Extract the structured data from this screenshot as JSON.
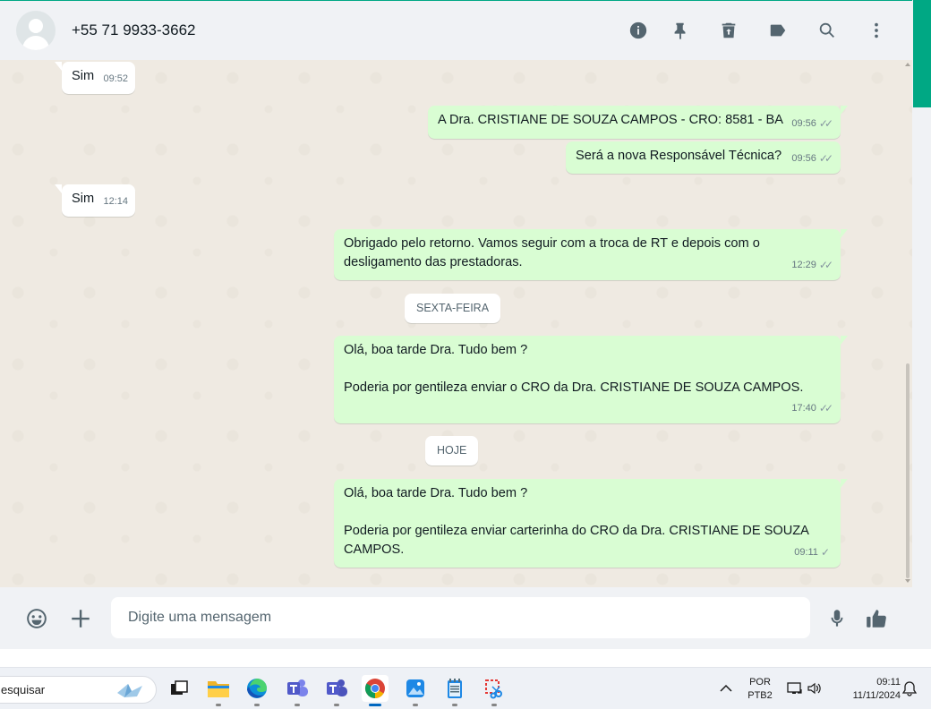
{
  "header": {
    "contact_name": "+55 71 9933-3662",
    "icons": [
      "info-icon",
      "pin-icon",
      "delete-icon",
      "label-icon",
      "search-icon",
      "menu-icon"
    ]
  },
  "messages": [
    {
      "direction": "in",
      "text": "Sim",
      "time": "09:52"
    },
    {
      "direction": "out",
      "text": "A Dra. CRISTIANE DE SOUZA CAMPOS - CRO: 8581 - BA",
      "time": "09:56",
      "status": "read"
    },
    {
      "direction": "out",
      "text": "Será a nova Responsável Técnica?",
      "time": "09:56",
      "status": "read"
    },
    {
      "direction": "in",
      "text": "Sim",
      "time": "12:14"
    },
    {
      "direction": "out",
      "lines": [
        "Obrigado pelo retorno. Vamos seguir com a troca de RT e depois com o",
        "desligamento das prestadoras."
      ],
      "time": "12:29",
      "status": "read"
    },
    {
      "direction": "out",
      "lines": [
        "Olá, boa tarde Dra. Tudo bem ?",
        "",
        "Poderia por gentileza enviar o CRO da Dra. CRISTIANE DE SOUZA CAMPOS."
      ],
      "time": "17:40",
      "status": "read"
    },
    {
      "direction": "out",
      "lines": [
        "Olá, boa tarde Dra. Tudo bem ?",
        "",
        "Poderia por gentileza enviar carterinha do CRO da Dra. CRISTIANE DE SOUZA",
        "CAMPOS."
      ],
      "time": "09:11",
      "status": "sent"
    }
  ],
  "date_chips": [
    "SEXTA-FEIRA",
    "HOJE"
  ],
  "composer": {
    "placeholder": "Digite uma mensagem"
  },
  "taskbar": {
    "search_text": "esquisar",
    "language": "POR",
    "layout": "PTB2",
    "time": "09:11",
    "date": "11/11/2024"
  },
  "colors": {
    "accent": "#00a884",
    "outgoing_bubble": "#d9fdd3",
    "incoming_bubble": "#ffffff",
    "chat_bg": "#efeae2"
  }
}
